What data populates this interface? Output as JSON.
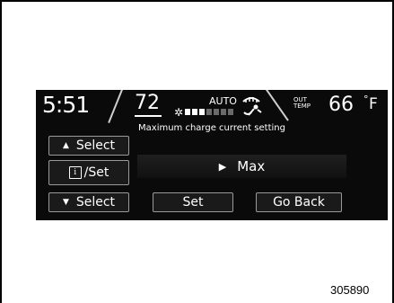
{
  "status": {
    "clock": "5:51",
    "set_temp": "72",
    "fan_level": 3,
    "fan_max": 7,
    "mode": "AUTO",
    "out_label_line1": "OUT",
    "out_label_line2": "TEMP",
    "outside_temp": "66",
    "deg_symbol": "°",
    "temp_unit": "F"
  },
  "screen": {
    "title": "Maximum charge current setting",
    "selected_value": "Max"
  },
  "buttons": {
    "select_up": "Select",
    "info_set": "/Set",
    "info_glyph": "i",
    "select_down": "Select",
    "set": "Set",
    "go_back": "Go Back"
  },
  "figure_number": "305890"
}
